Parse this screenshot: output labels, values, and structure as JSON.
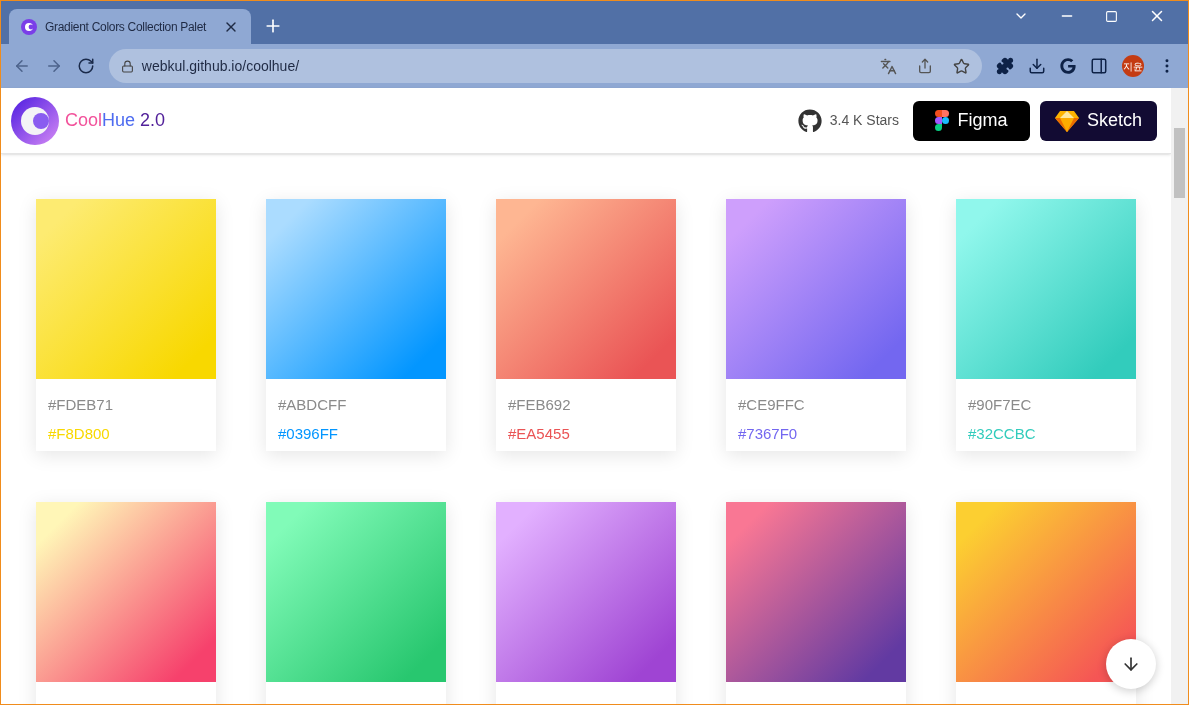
{
  "browser": {
    "tab": {
      "title": "Gradient Colors Collection Palet"
    },
    "url": "webkul.github.io/coolhue/",
    "profile": "지윤"
  },
  "header": {
    "brand": {
      "name_part1": "Cool",
      "name_part2": "Hue",
      "version": "2.0"
    },
    "stars": "3.4 K Stars",
    "buttons": [
      {
        "kind": "figma",
        "label": "Figma"
      },
      {
        "kind": "sketch",
        "label": "Sketch"
      }
    ]
  },
  "swatches": [
    {
      "from": {
        "text": "#FDEB71",
        "color": "#fdeb71"
      },
      "to": {
        "text": "#F8D800",
        "color": "#f8d800"
      }
    },
    {
      "from": {
        "text": "#ABDCFF",
        "color": "#abdcff"
      },
      "to": {
        "text": "#0396FF",
        "color": "#0396ff"
      }
    },
    {
      "from": {
        "text": "#FEB692",
        "color": "#feb692"
      },
      "to": {
        "text": "#EA5455",
        "color": "#ea5455"
      }
    },
    {
      "from": {
        "text": "#CE9FFC",
        "color": "#ce9ffc"
      },
      "to": {
        "text": "#7367F0",
        "color": "#7367f0"
      }
    },
    {
      "from": {
        "text": "#90F7EC",
        "color": "#90f7ec"
      },
      "to": {
        "text": "#32CCBC",
        "color": "#32ccbc"
      }
    },
    {
      "from": {
        "color": "#fff6b7"
      },
      "to": {
        "color": "#f6416c"
      }
    },
    {
      "from": {
        "color": "#81fbb8"
      },
      "to": {
        "color": "#28c76f"
      }
    },
    {
      "from": {
        "color": "#e2b0ff"
      },
      "to": {
        "color": "#9f44d3"
      }
    },
    {
      "from": {
        "color": "#f97794"
      },
      "to": {
        "color": "#623aa2"
      }
    },
    {
      "from": {
        "color": "#fccf31"
      },
      "to": {
        "color": "#f55555"
      }
    }
  ]
}
